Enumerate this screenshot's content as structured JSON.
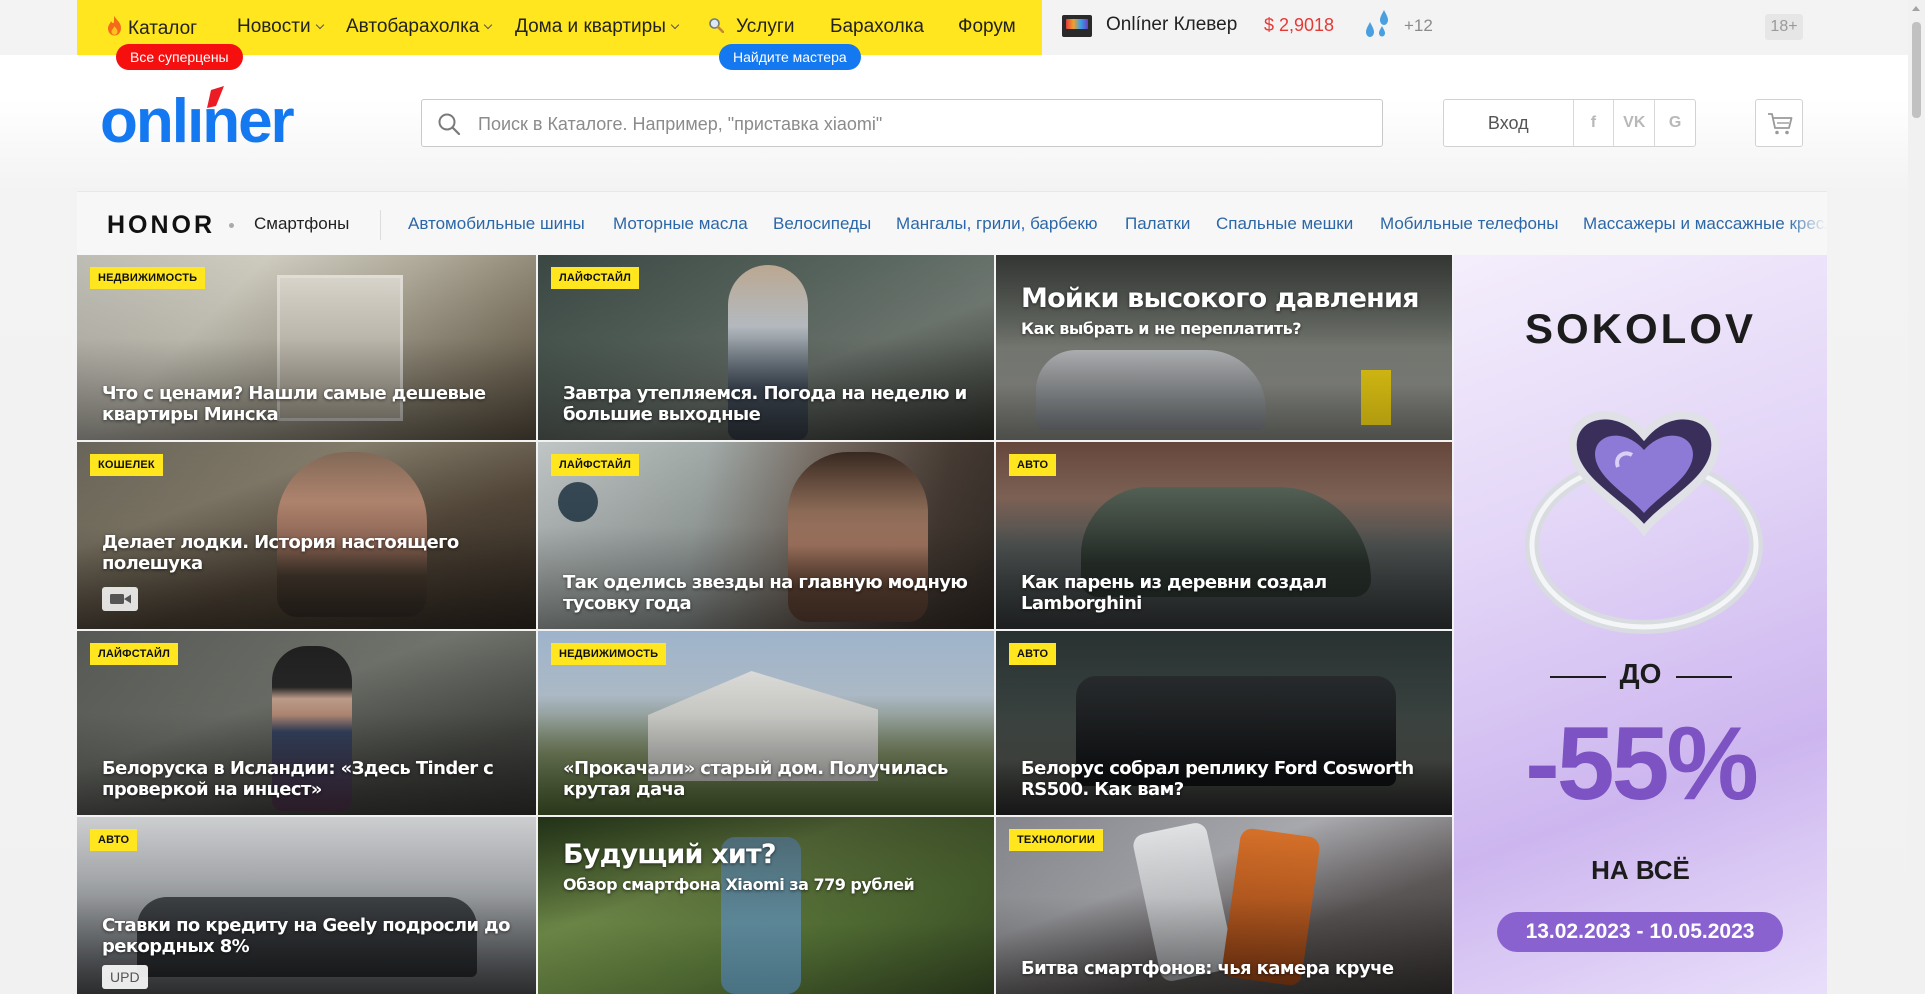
{
  "topnav": {
    "items": [
      {
        "label": "Каталог"
      },
      {
        "label": "Новости"
      },
      {
        "label": "Автобарахолка"
      },
      {
        "label": "Дома и квартиры"
      },
      {
        "label": "Услуги"
      },
      {
        "label": "Барахолка"
      },
      {
        "label": "Форум"
      }
    ],
    "promo_red": "Все суперцены",
    "promo_blue": "Найдите мастера",
    "clever": "Onlíner Клевер",
    "currency": "$ 2,9018",
    "weather": "+12",
    "age": "18+"
  },
  "colors": {
    "accent_yellow": "#ffe61e",
    "brand_blue": "#1478f1",
    "promo_red": "#f50f0f",
    "currency_red": "#e53935"
  },
  "header": {
    "logo_text": "onlíner",
    "search_placeholder": "Поиск в Каталоге. Например, \"приставка xiaomi\"",
    "login_label": "Вход",
    "social": [
      "f",
      "VK",
      "G"
    ]
  },
  "catbar": {
    "brand": "HONOR",
    "brand_category": "Смартфоны",
    "links": [
      "Автомобильные шины",
      "Моторные масла",
      "Велосипеды",
      "Мангалы, грили, барбекю",
      "Палатки",
      "Спальные мешки",
      "Мобильные телефоны",
      "Массажеры и массажные кресла"
    ]
  },
  "tiles": [
    {
      "tag": "НЕДВИЖИМОСТЬ",
      "title": "Что с ценами? Нашли самые дешевые квартиры Минска"
    },
    {
      "tag": "ЛАЙФСТАЙЛ",
      "title": "Завтра утепляемся. Погода на неделю и большие выходные"
    },
    {
      "title": "Мойки высокого давления",
      "subtitle": "Как выбрать и не переплатить?"
    },
    {
      "tag": "КОШЕЛЕК",
      "title": "Делает лодки. История настоящего полешука"
    },
    {
      "tag": "ЛАЙФСТАЙЛ",
      "title": "Так оделись звезды на главную модную тусовку года"
    },
    {
      "tag": "АВТО",
      "title": "Как парень из деревни создал Lamborghini"
    },
    {
      "tag": "ЛАЙФСТАЙЛ",
      "title": "Белоруска в Исландии: «Здесь Tinder с проверкой на инцест»"
    },
    {
      "tag": "НЕДВИЖИМОСТЬ",
      "title": "«Прокачали» старый дом. Получилась крутая дача"
    },
    {
      "tag": "АВТО",
      "title": "Белорус собрал реплику Ford Cosworth RS500. Как вам?"
    },
    {
      "tag": "АВТО",
      "title": "Ставки по кредиту на Geely подросли до рекордных 8%",
      "badge": "UPD"
    },
    {
      "title": "Будущий хит?",
      "subtitle": "Обзор смартфона Xiaomi за 779 рублей"
    },
    {
      "tag": "ТЕХНОЛОГИИ",
      "title": "Битва смартфонов: чья камера круче"
    }
  ],
  "ad": {
    "brand": "SOKOLOV",
    "up_to": "ДО",
    "discount": "-55%",
    "on_all": "НА ВСЁ",
    "dates": "13.02.2023 - 10.05.2023"
  }
}
